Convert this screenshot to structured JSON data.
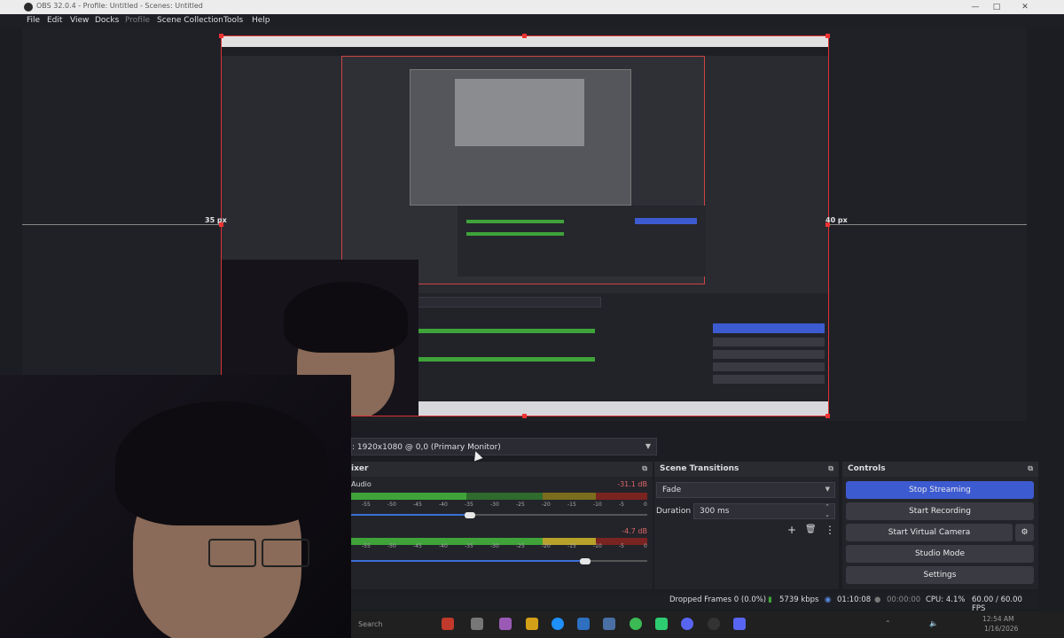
{
  "window": {
    "title": "OBS 32.0.4 - Profile: Untitled - Scenes: Untitled",
    "minimize": "—",
    "maximize": "□",
    "close": "✕"
  },
  "menu": [
    "File",
    "Edit",
    "View",
    "Docks",
    "Profile",
    "Scene Collection",
    "Tools",
    "Help"
  ],
  "preview": {
    "left_margin": "35 px",
    "right_margin": "40 px"
  },
  "source": {
    "display": ": 1920x1080 @ 0,0 (Primary Monitor)"
  },
  "mixer": {
    "title": "ixer",
    "channels": [
      {
        "name": "Audio",
        "db": "-31.1 dB",
        "fader": 0.4
      },
      {
        "name": "",
        "db": "-4.7 dB",
        "fader": 0.79
      }
    ],
    "scale": [
      "-55",
      "-50",
      "-45",
      "-40",
      "-35",
      "-30",
      "-25",
      "-20",
      "-15",
      "-10",
      "-5",
      "0"
    ]
  },
  "transitions": {
    "title": "Scene Transitions",
    "transition": "Fade",
    "duration_label": "Duration",
    "duration_value": "300 ms",
    "add": "+",
    "remove": "🗑",
    "more": "⋮"
  },
  "controls": {
    "title": "Controls",
    "stop_streaming": "Stop Streaming",
    "start_recording": "Start Recording",
    "start_virtual_camera": "Start Virtual Camera",
    "studio_mode": "Studio Mode",
    "settings": "Settings",
    "settings_icon": "⚙"
  },
  "status": {
    "dropped_frames": "Dropped Frames 0 (0.0%)",
    "bitrate": "5739 kbps",
    "stream_time": "01:10:08",
    "record_time": "00:00:00",
    "cpu": "CPU: 4.1%",
    "fps": "60.00 / 60.00 FPS"
  },
  "taskbar": {
    "search": "Search",
    "time": "12:54 AM",
    "date": "1/16/2026"
  },
  "colors": {
    "accent": "#3d5bd0",
    "selection": "#dd3333",
    "meter_green": "#3fa33a",
    "meter_yellow": "#b8a22a",
    "meter_red": "#b8322e"
  }
}
